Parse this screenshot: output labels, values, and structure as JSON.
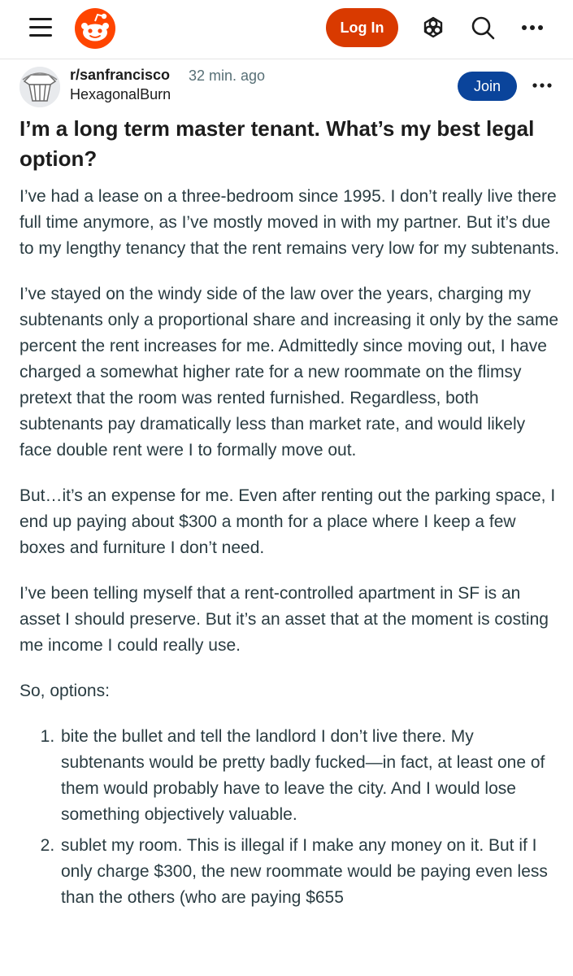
{
  "header": {
    "login_label": "Log In"
  },
  "icons": {
    "menu": "hamburger-menu-icon",
    "logo": "reddit-logo",
    "advertise": "popular-icon",
    "search": "search-icon",
    "more": "more-options-icon"
  },
  "colors": {
    "brand_orange": "#FF4500",
    "login_button": "#D93A00",
    "join_button": "#0A449B",
    "meta_gray": "#576F76",
    "body_text": "#2A3C42"
  },
  "post": {
    "subreddit": "r/sanfrancisco",
    "time_ago": "32 min. ago",
    "author": "HexagonalBurn",
    "join_label": "Join",
    "title": "I’m a long term master tenant. What’s my best legal option?",
    "paragraphs": [
      "I’ve had a lease on a three-bedroom since 1995. I don’t really live there full time anymore, as I’ve mostly moved in with my partner. But it’s due to my lengthy tenancy that the rent remains very low for my subtenants.",
      "I’ve stayed on the windy side of the law over the years, charging my subtenants only a proportional share and increasing it only by the same percent the rent increases for me. Admittedly since moving out, I have charged a somewhat higher rate for a new roommate on the flimsy pretext that the room was rented furnished. Regardless, both subtenants pay dramatically less than market rate, and would likely face double rent were I to formally move out.",
      "But…it’s an expense for me. Even after renting out the parking space, I end up paying about $300 a month for a place where I keep a few boxes and furniture I don’t need.",
      "I’ve been telling myself that a rent-controlled apartment in SF is an asset I should preserve. But it’s an asset that at the moment is costing me income I could really use.",
      "So, options:"
    ],
    "options": [
      "bite the bullet and tell the landlord I don’t live there. My subtenants would be pretty badly fucked—in fact, at least one of them would probably have to leave the city. And I would lose something objectively valuable.",
      "sublet my room. This is illegal if I make any money on it. But if I only charge $300, the new roommate would be paying even less than the others (who are paying $655"
    ]
  }
}
